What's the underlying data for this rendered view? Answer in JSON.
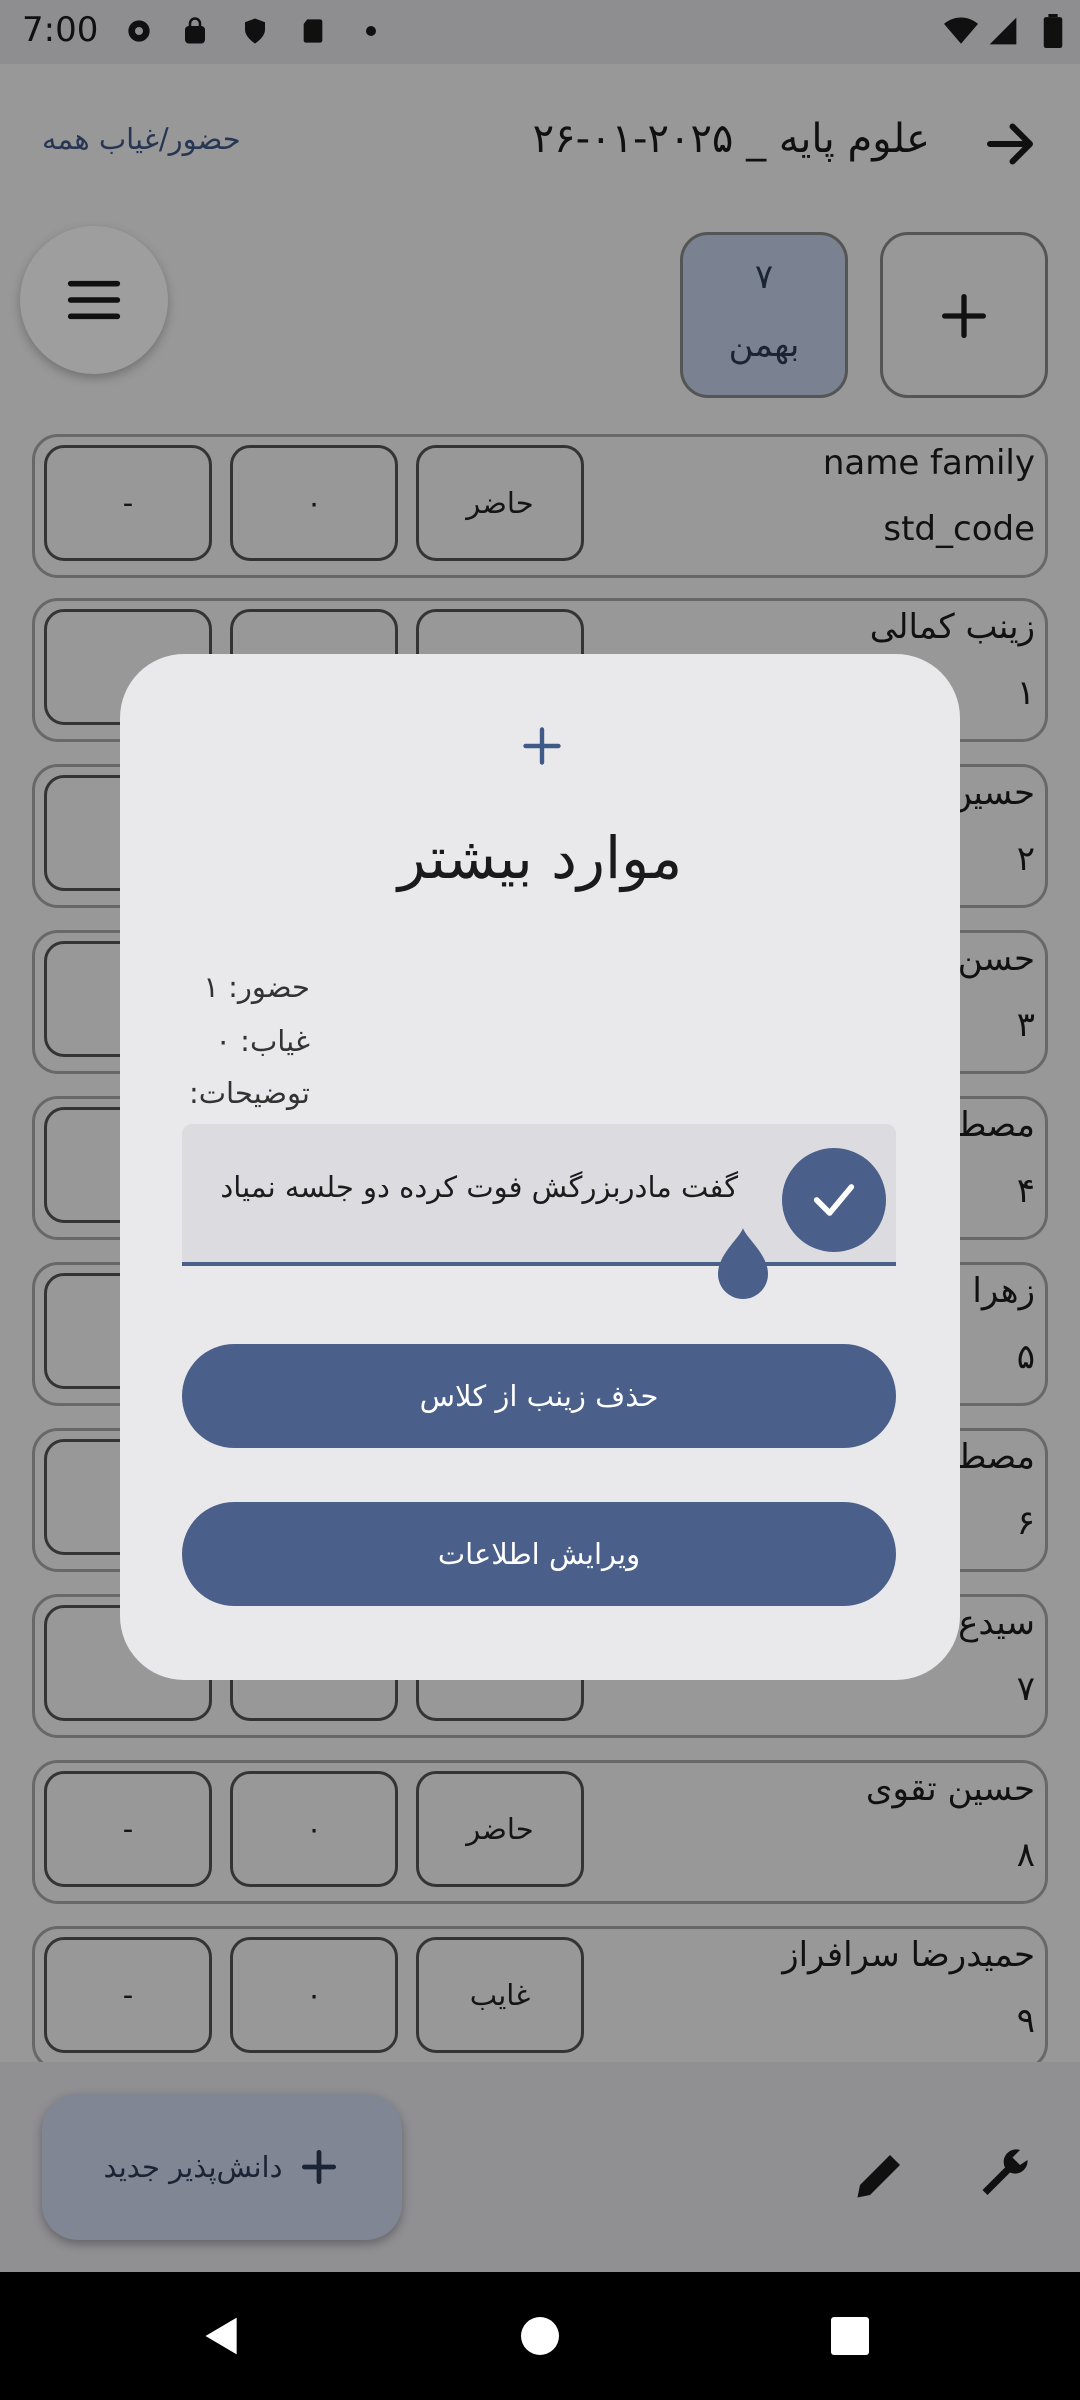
{
  "status_bar": {
    "time": "7:00"
  },
  "header": {
    "title": "علوم پایه _ ۲۰۲۵-۰۱-۲۶",
    "all_attendance_link": "حضور/غیاب همه"
  },
  "date_chip": {
    "day": "۷",
    "month": "بهمن"
  },
  "rows": [
    {
      "name": "name family",
      "code": "std_code",
      "status": "حاضر",
      "count": "۰",
      "extra": "-"
    },
    {
      "name": "زینب کمالی",
      "code": "۱",
      "status": "",
      "count": "",
      "extra": ""
    },
    {
      "name": "حسین",
      "code": "۲",
      "status": "",
      "count": "",
      "extra": ""
    },
    {
      "name": "حسن",
      "code": "۳",
      "status": "",
      "count": "",
      "extra": ""
    },
    {
      "name": "مصطف",
      "code": "۴",
      "status": "",
      "count": "",
      "extra": ""
    },
    {
      "name": "زهرا ه",
      "code": "۵",
      "status": "",
      "count": "",
      "extra": ""
    },
    {
      "name": "مصطف",
      "code": "۶",
      "status": "",
      "count": "",
      "extra": ""
    },
    {
      "name": "سیدع",
      "code": "۷",
      "status": "",
      "count": "",
      "extra": ""
    },
    {
      "name": "حسین تقوی",
      "code": "۸",
      "status": "حاضر",
      "count": "۰",
      "extra": "-"
    },
    {
      "name": "حمیدرضا سرافراز",
      "code": "۹",
      "status": "غایب",
      "count": "۰",
      "extra": "-"
    }
  ],
  "fab": {
    "new_student": "دانش‌پذیر جدید"
  },
  "dialog": {
    "title": "موارد بیشتر",
    "present_label": "حضور: ۱",
    "absent_label": "غیاب: ۰",
    "notes_label": "توضیحات:",
    "notes_value": "گفت مادربزرگش فوت کرده دو جلسه نمیاد",
    "delete_button": "حذف زینب از کلاس",
    "edit_button": "ویرایش اطلاعات"
  },
  "colors": {
    "accent": "#4a5f8a",
    "chip_bg": "#c6d2ea",
    "dialog_bg": "#e9e9ec"
  }
}
